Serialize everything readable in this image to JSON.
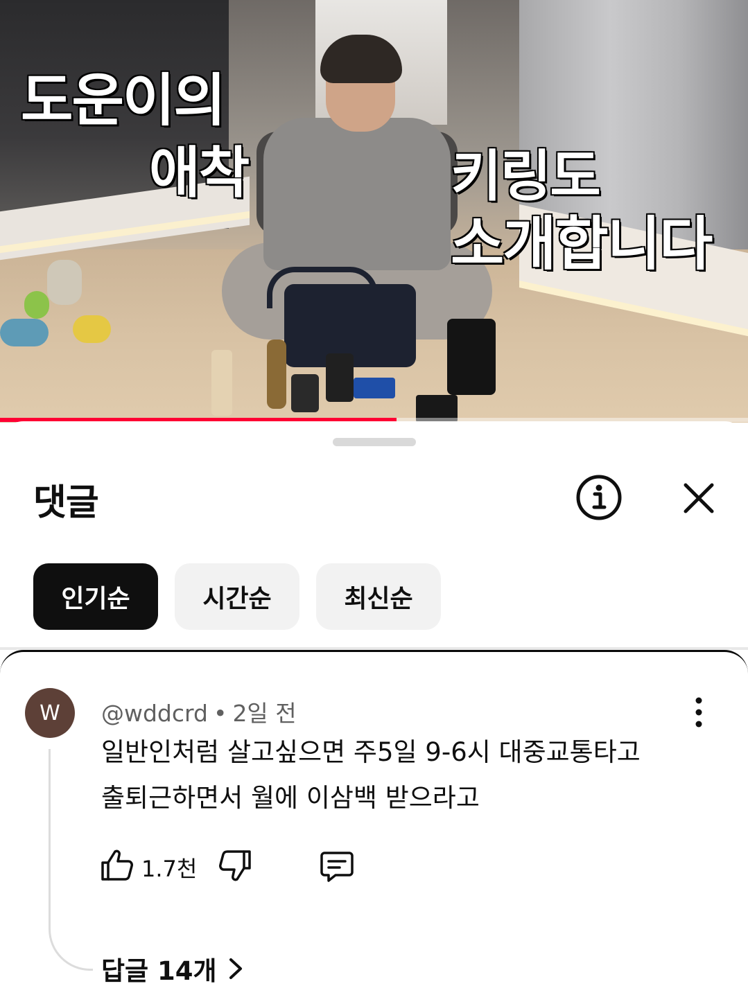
{
  "video": {
    "overlay_lines": [
      "도운이의",
      "애착",
      "키링도",
      "소개합니다"
    ],
    "progress_fraction": 0.53,
    "progress_color": "#ff0033"
  },
  "comments_panel": {
    "title": "댓글",
    "info_icon": "info-icon",
    "close_icon": "close-icon",
    "sort_chips": [
      {
        "label": "인기순",
        "selected": true
      },
      {
        "label": "시간순",
        "selected": false
      },
      {
        "label": "최신순",
        "selected": false
      }
    ]
  },
  "comment": {
    "avatar_letter": "W",
    "avatar_color": "#5d4037",
    "handle": "@wddcrd",
    "separator": "•",
    "time": "2일 전",
    "text_line1": "일반인처럼 살고싶으면 주5일 9-6시 대중교통타고",
    "text_line2": "출퇴근하면서 월에 이삼백 받으라고",
    "like_count": "1.7천",
    "replies_label": "답글 14개"
  }
}
